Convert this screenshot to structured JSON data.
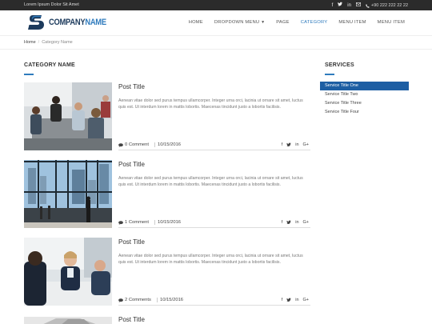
{
  "topbar": {
    "tagline": "Lorem Ipsum Dolor Sit Amet",
    "social": [
      "facebook-icon",
      "twitter-icon",
      "linkedin-icon",
      "mail-icon"
    ],
    "phone": "+90 222 222 22 22"
  },
  "header": {
    "logo_part1": "COMPANY",
    "logo_part2": "NAME",
    "nav": [
      {
        "label": "HOME",
        "active": false
      },
      {
        "label": "DROPDOWN MENU",
        "active": false,
        "caret": true
      },
      {
        "label": "PAGE",
        "active": false
      },
      {
        "label": "CATEGORY",
        "active": true
      },
      {
        "label": "MENU ITEM",
        "active": false
      },
      {
        "label": "MENU ITEM",
        "active": false
      }
    ]
  },
  "breadcrumb": {
    "home": "Home",
    "separator": "/",
    "current": "Category Name"
  },
  "main": {
    "title": "CATEGORY NAME",
    "posts": [
      {
        "title": "Post Title",
        "excerpt": "Aenean vitae dolor sed purus tempus ullamcorper. Integer urna orci, lacinia ut ornare sit amet, luctus quis est. Ut interdum lorem in mattis lobortis. Maecenas tincidunt justo a lobortis facilisis.",
        "comments": "0 Comment",
        "date": "10/15/2016"
      },
      {
        "title": "Post Title",
        "excerpt": "Aenean vitae dolor sed purus tempus ullamcorper. Integer urna orci, lacinia ut ornare sit amet, luctus quis est. Ut interdum lorem in mattis lobortis. Maecenas tincidunt justo a lobortis facilisis.",
        "comments": "1 Comment",
        "date": "10/15/2016"
      },
      {
        "title": "Post Title",
        "excerpt": "Aenean vitae dolor sed purus tempus ullamcorper. Integer urna orci, lacinia ut ornare sit amet, luctus quis est. Ut interdum lorem in mattis lobortis. Maecenas tincidunt justo a lobortis facilisis.",
        "comments": "2 Comments",
        "date": "10/15/2016"
      },
      {
        "title": "Post Title"
      }
    ],
    "share": [
      "f",
      "twitter-icon",
      "in",
      "G+"
    ]
  },
  "sidebar": {
    "title": "SERVICES",
    "items": [
      {
        "label": "Service Title One",
        "active": true
      },
      {
        "label": "Service Title Two",
        "active": false
      },
      {
        "label": "Service Title Three",
        "active": false
      },
      {
        "label": "Service Title Four",
        "active": false
      }
    ]
  },
  "colors": {
    "accent": "#2f7bbd",
    "active_bg": "#1d5ea3",
    "topbar_bg": "#2b2b2b"
  }
}
